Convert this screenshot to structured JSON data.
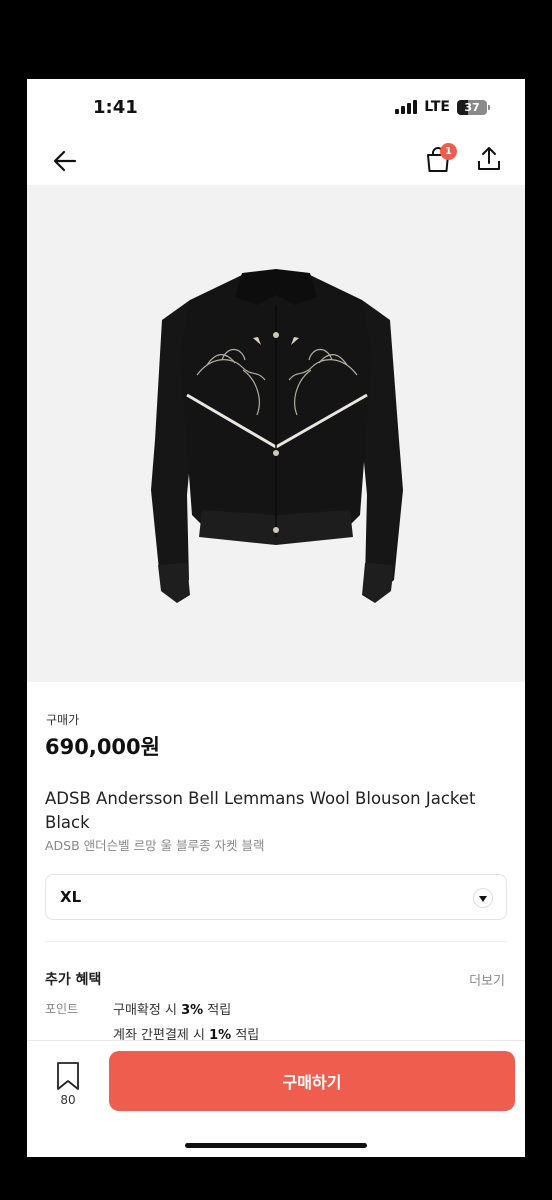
{
  "status_bar": {
    "time": "1:41",
    "network": "LTE",
    "battery": "37",
    "battery_level": 0.37
  },
  "nav": {
    "cart_count": "1"
  },
  "product": {
    "price_label": "구매가",
    "price": "690,000원",
    "title": "ADSB Andersson Bell Lemmans Wool Blouson Jacket Black",
    "subtitle": "ADSB 앤더슨벨 르망 울 블루종 자켓 블랙",
    "size": "XL"
  },
  "benefits": {
    "title": "추가 혜택",
    "more": "더보기",
    "point_label": "포인트",
    "line1_prefix": "구매확정 시 ",
    "line1_value": "3%",
    "line1_suffix": " 적립",
    "line2_prefix": "계좌 간편결제 시 ",
    "line2_value": "1%",
    "line2_suffix": " 적립"
  },
  "bottom": {
    "bookmark_count": "80",
    "buy_label": "구매하기"
  },
  "colors": {
    "accent": "#ef5d4e",
    "background": "#ffffff",
    "image_bg": "#f2f2f2"
  },
  "icons": [
    "back-arrow-icon",
    "shopping-bag-icon",
    "share-icon",
    "bookmark-icon",
    "chevron-down-icon"
  ]
}
